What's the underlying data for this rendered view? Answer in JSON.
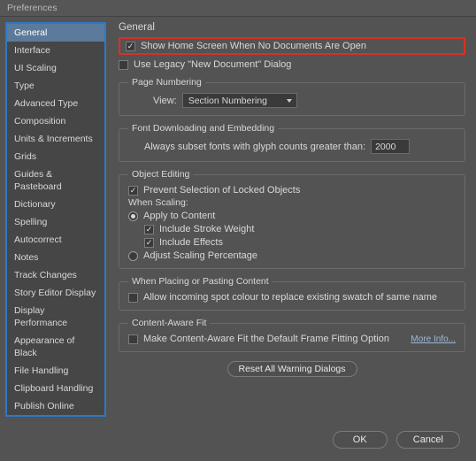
{
  "title": "Preferences",
  "sidebar": {
    "items": [
      "General",
      "Interface",
      "UI Scaling",
      "Type",
      "Advanced Type",
      "Composition",
      "Units & Increments",
      "Grids",
      "Guides & Pasteboard",
      "Dictionary",
      "Spelling",
      "Autocorrect",
      "Notes",
      "Track Changes",
      "Story Editor Display",
      "Display Performance",
      "Appearance of Black",
      "File Handling",
      "Clipboard Handling",
      "Publish Online"
    ],
    "selectedIndex": 0
  },
  "general": {
    "heading": "General",
    "showHomeScreen": {
      "label": "Show Home Screen When No Documents Are Open",
      "checked": true
    },
    "legacyNewDoc": {
      "label": "Use Legacy \"New Document\" Dialog",
      "checked": false
    },
    "pageNumbering": {
      "legend": "Page Numbering",
      "viewLabel": "View:",
      "viewValue": "Section Numbering"
    },
    "fontDownload": {
      "legend": "Font Downloading and Embedding",
      "subsetLabel": "Always subset fonts with glyph counts greater than:",
      "subsetValue": "2000"
    },
    "objectEditing": {
      "legend": "Object Editing",
      "preventSelection": {
        "label": "Prevent Selection of Locked Objects",
        "checked": true
      },
      "whenScaling": "When Scaling:",
      "applyToContent": {
        "label": "Apply to Content",
        "checked": true
      },
      "includeStroke": {
        "label": "Include Stroke Weight",
        "checked": true
      },
      "includeEffects": {
        "label": "Include Effects",
        "checked": true
      },
      "adjustScaling": {
        "label": "Adjust Scaling Percentage",
        "checked": false
      }
    },
    "placing": {
      "legend": "When Placing or Pasting Content",
      "allowIncoming": {
        "label": "Allow incoming spot colour to replace existing swatch of same name",
        "checked": false
      }
    },
    "contentAware": {
      "legend": "Content-Aware Fit",
      "makeDefault": {
        "label": "Make Content-Aware Fit the Default Frame Fitting Option",
        "checked": false
      },
      "moreInfo": "More Info..."
    },
    "resetDialogs": "Reset All Warning Dialogs"
  },
  "buttons": {
    "ok": "OK",
    "cancel": "Cancel"
  }
}
